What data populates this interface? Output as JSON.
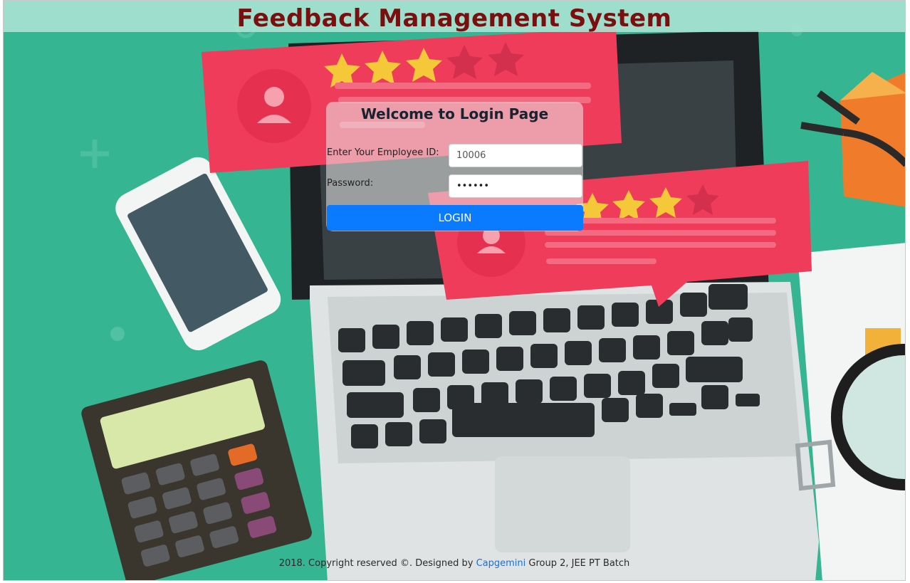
{
  "page": {
    "title": "Feedback Management System"
  },
  "login": {
    "heading": "Welcome to Login Page",
    "employee_id_label": "Enter Your Employee ID:",
    "employee_id_value": "10006",
    "password_label": "Password:",
    "password_value": "••••••",
    "login_button": "LOGIN"
  },
  "footer": {
    "prefix": "2018. Copyright reserved ©. Designed by",
    "link": "Capgemini",
    "suffix": "Group 2, JEE PT Batch"
  },
  "colors": {
    "background": "#35b592",
    "title": "#7a0f0f",
    "button": "#0a7bff",
    "card": "#ef3c5a"
  }
}
